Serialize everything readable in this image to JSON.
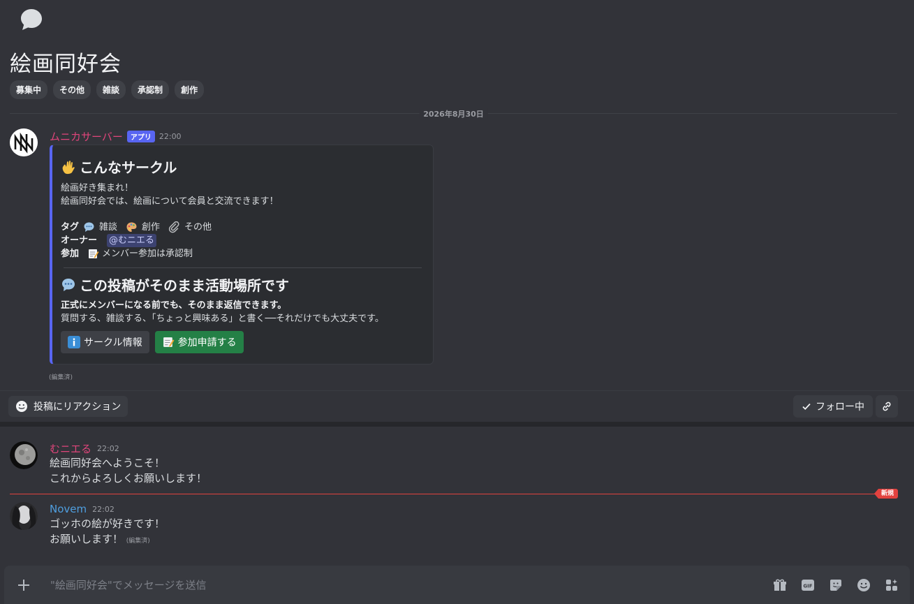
{
  "thread": {
    "title": "絵画同好会",
    "tags": [
      "募集中",
      "その他",
      "雑談",
      "承認制",
      "創作"
    ]
  },
  "date_divider": "2026年8月30日",
  "bot_message": {
    "author": "ムニカサーバー",
    "author_color": "#e0457b",
    "badge": "アプリ",
    "time": "22:00",
    "embed": {
      "title": "こんなサークル",
      "description_line1": "絵画好き集まれ！",
      "description_line2": "絵画同好会では、絵画について会員と交流できます！",
      "tags_label": "タグ",
      "tag_items": [
        "雑談",
        "創作",
        "その他"
      ],
      "owner_label": "オーナー",
      "owner_mention": "@むニエる",
      "join_label": "参加",
      "join_value": "メンバー参加は承認制",
      "section_title": "この投稿がそのまま活動場所です",
      "section_bold": "正式にメンバーになる前でも、そのまま返信できます。",
      "section_text": "質問する、雑談する、「ちょっと興味ある」と書く──それだけでも大丈夫です。",
      "button_info": "サークル情報",
      "button_join": "参加申請する"
    },
    "edited": "(編集済)"
  },
  "actions": {
    "react": "投稿にリアクション",
    "follow": "フォロー中"
  },
  "messages": [
    {
      "author": "むニエる",
      "author_color": "#e0457b",
      "time": "22:02",
      "lines": [
        "絵画同好会へようこそ！",
        "これからよろしくお願いします！"
      ]
    },
    {
      "author": "Novem",
      "author_color": "#4f9fe0",
      "time": "22:02",
      "lines": [
        "ゴッホの絵が好きです！",
        "お願いします！"
      ],
      "edited": "(編集済)"
    }
  ],
  "new_badge": "新規",
  "composer": {
    "placeholder": "\"絵画同好会\"でメッセージを送信"
  }
}
